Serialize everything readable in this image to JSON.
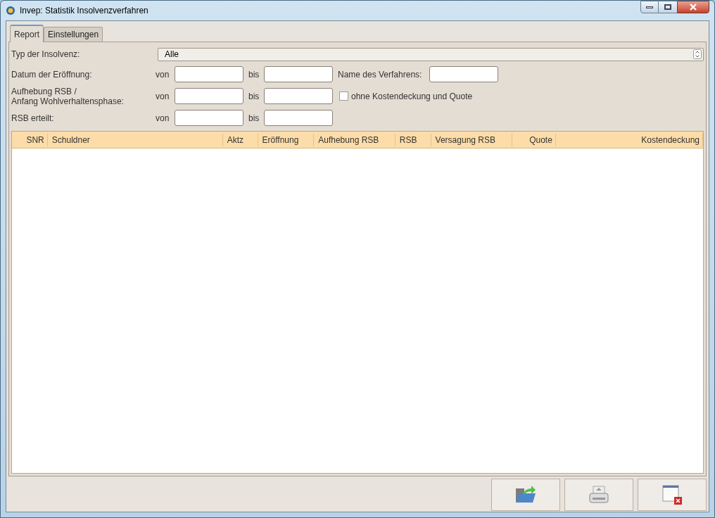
{
  "window": {
    "title": "Invep: Statistik Insolvenzverfahren"
  },
  "tabs": [
    {
      "label": "Report",
      "selected": true
    },
    {
      "label": "Einstellungen",
      "selected": false
    }
  ],
  "form": {
    "type_label": "Typ der Insolvenz:",
    "type_value": "Alle",
    "rows": [
      {
        "label": "Datum der Eröffnung:",
        "from": "von",
        "to": "bis",
        "extra_label": "Name des Verfahrens:"
      },
      {
        "label": "Aufhebung RSB /\nAnfang Wohlverhaltensphase:",
        "from": "von",
        "to": "bis",
        "checkbox": {
          "label": "ohne Kostendeckung und Quote",
          "checked": false
        }
      },
      {
        "label": "RSB erteilt:",
        "from": "von",
        "to": "bis"
      }
    ]
  },
  "table": {
    "columns": [
      "SNR",
      "Schuldner",
      "Aktz",
      "Eröffnung",
      "Aufhebung RSB",
      "RSB",
      "Versagung RSB",
      "Quote",
      "Kostendeckung"
    ]
  }
}
